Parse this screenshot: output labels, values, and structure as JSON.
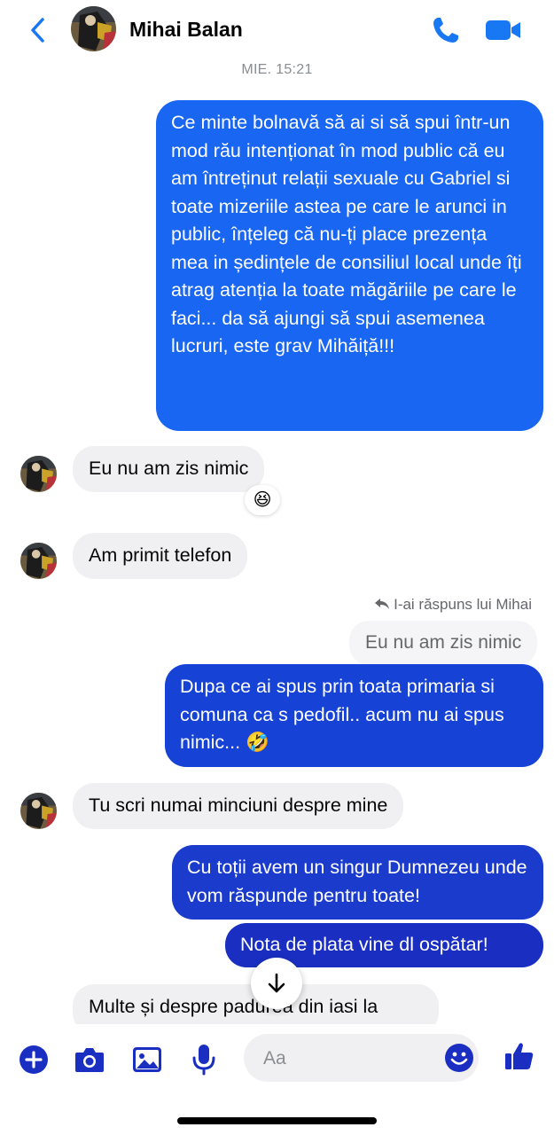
{
  "header": {
    "contact_name": "Mihai Balan",
    "back_icon": "chevron-left-icon",
    "call_icon": "phone-icon",
    "video_icon": "video-camera-icon",
    "accent": "#1877f2"
  },
  "timestamp": "MIE. 15:21",
  "messages": {
    "m1": "Ce minte bolnavă să ai si să spui într-un mod rău intenționat în mod public că eu am întreținut relații sexuale cu Gabriel si toate mizeriile astea pe care le arunci in public, înțeleg că nu-ți place prezența mea in ședințele de consiliul local unde îți atrag atenția la toate măgăriile pe care le faci... da să ajungi să spui asemenea lucruri, este grav Mihăiță!!!",
    "m2": "Eu nu am zis nimic",
    "m2_reaction": "😆",
    "m3": "Am primit telefon",
    "reply_label": "I-ai răspuns lui Mihai",
    "reply_quote": "Eu nu am zis nimic",
    "m4": "Dupa ce ai spus prin toata primaria si comuna ca s pedofil.. acum nu ai spus nimic... 🤣",
    "m5": "Tu scri numai minciuni despre mine",
    "m6": "Cu toții avem un singur Dumnezeu unde vom răspunde pentru toate!",
    "m7": "Nota de plata vine dl ospătar!",
    "m8": "Multe și despre padurea din iasi la"
  },
  "composer": {
    "placeholder": "Aa",
    "icons": [
      "plus-icon",
      "camera-icon",
      "image-icon",
      "microphone-icon",
      "emoji-icon",
      "thumbs-up-icon"
    ]
  }
}
